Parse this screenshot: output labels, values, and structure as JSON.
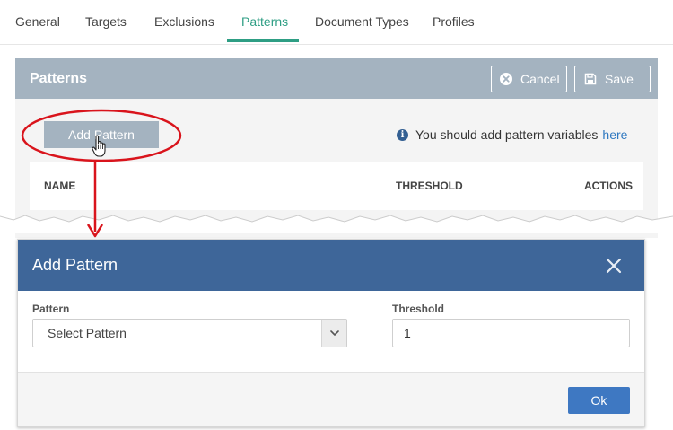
{
  "tabs": [
    {
      "label": "General"
    },
    {
      "label": "Targets"
    },
    {
      "label": "Exclusions"
    },
    {
      "label": "Patterns",
      "active": true
    },
    {
      "label": "Document Types"
    },
    {
      "label": "Profiles"
    }
  ],
  "panel": {
    "title": "Patterns",
    "cancel_label": "Cancel",
    "save_label": "Save",
    "add_pattern_label": "Add Pattern",
    "info_text": "You should add pattern variables",
    "info_link": "here",
    "columns": [
      "NAME",
      "THRESHOLD",
      "ACTIONS"
    ]
  },
  "modal": {
    "title": "Add Pattern",
    "pattern_label": "Pattern",
    "pattern_value": "Select Pattern",
    "threshold_label": "Threshold",
    "threshold_value": "1",
    "ok_label": "Ok"
  },
  "icons": {
    "cancel": "x-circle-icon",
    "save": "floppy-disk-icon",
    "info": "info-circle-icon",
    "close": "close-icon",
    "select_caret": "chevron-down-icon",
    "cursor": "hand-pointer-icon"
  },
  "colors": {
    "accent_tab": "#2e9e84",
    "panel_header": "#a4b3c0",
    "modal_header": "#3e6699",
    "ok_button": "#3e78c2",
    "annotation": "#d9141c",
    "link": "#2f78c0"
  }
}
